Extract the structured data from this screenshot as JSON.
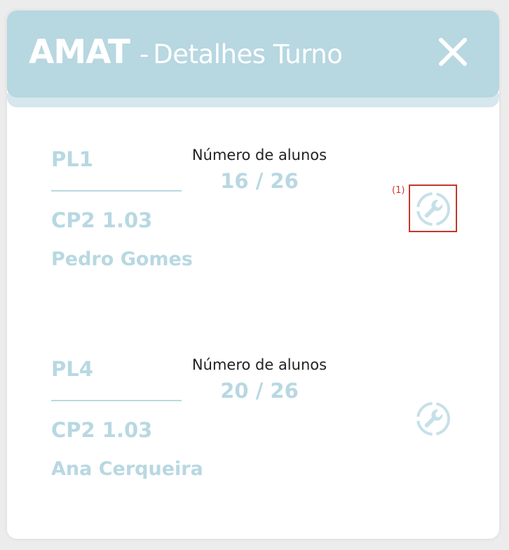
{
  "header": {
    "course": "AMAT",
    "separator": "-",
    "title": "Detalhes Turno"
  },
  "shifts": [
    {
      "name": "PL1",
      "room": "CP2 1.03",
      "teacher": "Pedro Gomes",
      "students_label": "Número de alunos",
      "students_count": "16 / 26"
    },
    {
      "name": "PL4",
      "room": "CP2 1.03",
      "teacher": "Ana Cerqueira",
      "students_label": "Número de alunos",
      "students_count": "20 / 26"
    }
  ],
  "annotation": {
    "label": "(1)"
  },
  "colors": {
    "header_bg": "#b7d7e1",
    "accent_text": "#b8d8e2",
    "annotation": "#c0392b"
  },
  "icons": {
    "close": "close-icon",
    "settings": "wrench-icon"
  }
}
